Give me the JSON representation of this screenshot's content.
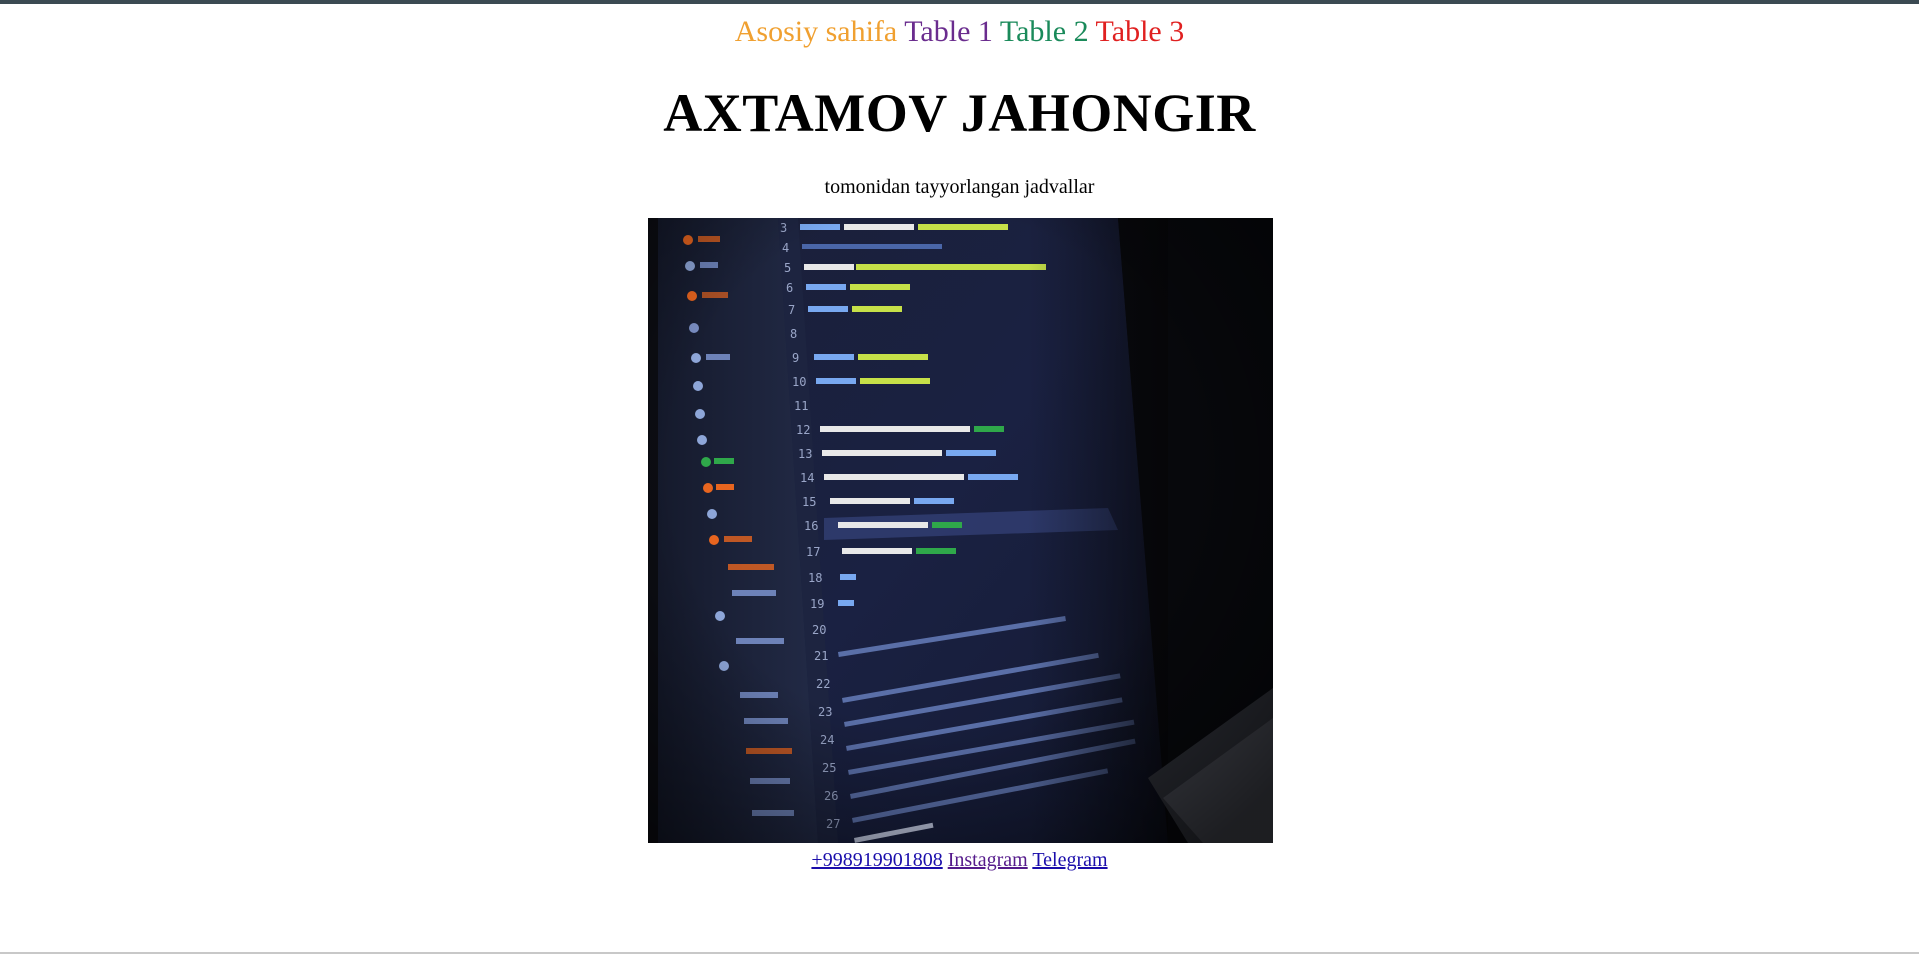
{
  "nav": {
    "items": [
      {
        "label": "Asosiy sahifa"
      },
      {
        "label": "Table 1"
      },
      {
        "label": "Table 2"
      },
      {
        "label": "Table 3"
      }
    ]
  },
  "header": {
    "title": "AXTAMOV JAHONGIR",
    "subtitle": "tomonidan tayyorlangan jadvallar"
  },
  "image": {
    "description_icon": "code-editor-photo"
  },
  "contacts": {
    "phone": "+998919901808",
    "instagram": "Instagram",
    "telegram": "Telegram"
  },
  "colors": {
    "nav_home": "#f0a030",
    "nav_table1": "#6a2c8e",
    "nav_table2": "#1a8a5a",
    "nav_table3": "#e02020",
    "top_bar": "#3b4a52"
  }
}
